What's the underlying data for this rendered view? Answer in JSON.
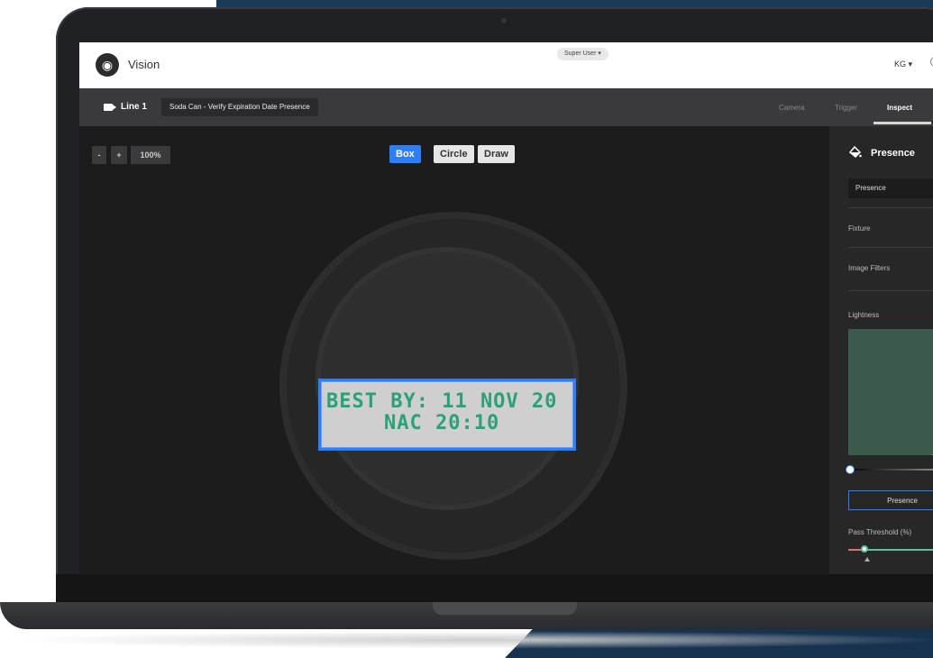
{
  "header": {
    "app_name": "Vision",
    "role": "Super User ▾",
    "user": "KG ▾"
  },
  "toolbar": {
    "line": "Line 1",
    "job_name": "Soda Can - Verify Expiration Date Presence",
    "tabs": [
      "Camera",
      "Trigger",
      "Inspect"
    ],
    "active_tab": "Inspect"
  },
  "canvas": {
    "zoom_out": "-",
    "zoom_in": "+",
    "zoom_level": "100%",
    "roi_tools": [
      "Box",
      "Circle",
      "Draw"
    ],
    "active_roi_tool": "Box",
    "roi_text_line1": "BEST BY: 11 NOV 20",
    "roi_text_line2": "NAC 20:10"
  },
  "panel": {
    "title": "Presence",
    "tool_select": "Presence",
    "fixture_label": "Fixture",
    "image_filters_label": "Image Filters",
    "lightness_label": "Lightness",
    "presence_button": "Presence",
    "threshold_label": "Pass Threshold (%)"
  },
  "colors": {
    "accent": "#2d7ff9",
    "roi_text": "#2aa276",
    "toolbar": "#3a3a3c",
    "panel": "#272728"
  }
}
